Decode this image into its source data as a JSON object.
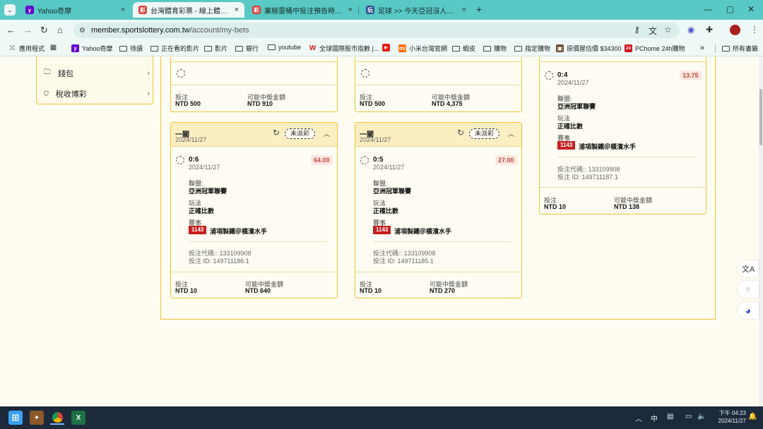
{
  "browser": {
    "tabs": [
      {
        "title": "Yahoo奇摩",
        "fav_color": "#6001d2",
        "fav_glyph": "y"
      },
      {
        "title": "台灣體育彩票 - 線上體育博彩",
        "fav_color": "#e03a3a",
        "fav_glyph": "彩"
      },
      {
        "title": "業極靈桶中投注預告時間表 - 台",
        "fav_color": "#e03a3a",
        "fav_glyph": "彩"
      },
      {
        "title": "足球 >> 今天亞冠沒人玩？ - 玩",
        "fav_color": "#2b4c8c",
        "fav_glyph": "玩"
      }
    ],
    "new_tab": "+",
    "url_host": "member.sportslottery.com.tw",
    "url_path": "/account/my-bets"
  },
  "bookmarks": [
    {
      "label": "應用程式",
      "type": "grid"
    },
    {
      "label": "",
      "type": "grid2"
    },
    {
      "label": "Yahoo奇摩",
      "type": "yahoo"
    },
    {
      "label": "待讀",
      "type": "folder"
    },
    {
      "label": "正在看的影片",
      "type": "folder"
    },
    {
      "label": "影片",
      "type": "folder"
    },
    {
      "label": "銀行",
      "type": "folder"
    },
    {
      "label": "youtube",
      "type": "folder"
    },
    {
      "label": "全球國際股市指數 |...",
      "type": "w"
    },
    {
      "label": "",
      "type": "yt"
    },
    {
      "label": "小米台灣官網",
      "type": "mi"
    },
    {
      "label": "蝦皮",
      "type": "folder"
    },
    {
      "label": "購物",
      "type": "folder"
    },
    {
      "label": "指定購物",
      "type": "folder"
    },
    {
      "label": "原價屋估價 $34300",
      "type": "img"
    },
    {
      "label": "PChome 24h購物",
      "type": "pc"
    },
    {
      "label": "»",
      "type": "more"
    },
    {
      "label": "所有書籤",
      "type": "folder"
    }
  ],
  "sidebar": {
    "items": [
      {
        "label": "錢包",
        "icon": "folder-icon"
      },
      {
        "label": "稅收博彩",
        "icon": "shield-icon"
      }
    ]
  },
  "labels": {
    "stake": "投注",
    "potential": "可能中獎金額",
    "league": "聯盟:",
    "market": "玩法",
    "event": "賽事",
    "bet_code_prefix": "投注代碼:: ",
    "bet_id_prefix": "投注 ID: "
  },
  "top_cards": [
    {
      "stake": "NTD 500",
      "potential": "NTD 910"
    },
    {
      "stake": "NTD 500",
      "potential": "NTD 4,375"
    }
  ],
  "cards": [
    {
      "title": "一關",
      "date": "2024/11/27",
      "status": "未派彩",
      "score": "0:6",
      "score_date": "2024/11/27",
      "odds": "64.00",
      "league": "亞洲冠軍聯賽",
      "market": "正確比數",
      "event_no": "1143",
      "event": "浦項製鐵＠橫濱水手",
      "bet_code": "133109908",
      "bet_id": "149711186.1",
      "stake": "NTD 10",
      "potential": "NTD 640"
    },
    {
      "title": "一關",
      "date": "2024/11/27",
      "status": "未派彩",
      "score": "0:5",
      "score_date": "2024/11/27",
      "odds": "27.00",
      "league": "亞洲冠軍聯賽",
      "market": "正確比數",
      "event_no": "1143",
      "event": "浦項製鐵＠橫濱水手",
      "bet_code": "133109908",
      "bet_id": "149711185.1",
      "stake": "NTD 10",
      "potential": "NTD 270"
    }
  ],
  "right_card": {
    "score": "0:4",
    "score_date": "2024/11/27",
    "odds": "13.75",
    "league": "亞洲冠軍聯賽",
    "market": "正確比數",
    "event_no": "1143",
    "event": "浦項製鐵＠橫濱水手",
    "bet_code": "133109908",
    "bet_id": "149711187.1",
    "stake": "NTD 10",
    "potential": "NTD 138"
  },
  "taskbar": {
    "tray_ime": "中",
    "time_line1": "下午 04:23",
    "time_line2": "2024/11/27"
  }
}
